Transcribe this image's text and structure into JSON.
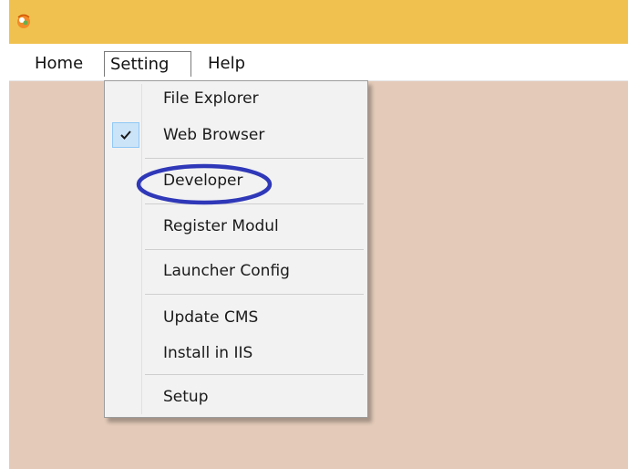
{
  "titlebar": {
    "icon": "app-icon"
  },
  "menubar": {
    "items": [
      {
        "label": "Home"
      },
      {
        "label": "Setting"
      },
      {
        "label": "Help"
      }
    ]
  },
  "setting_menu": {
    "items": [
      {
        "label": "File Explorer",
        "checked": false
      },
      {
        "label": "Web Browser",
        "checked": true
      },
      {
        "label": "Developer",
        "checked": false,
        "circled": true
      },
      {
        "label": "Register Modul",
        "checked": false
      },
      {
        "label": "Launcher Config",
        "checked": false
      },
      {
        "label": "Update CMS",
        "checked": false
      },
      {
        "label": "Install in IIS",
        "checked": false
      },
      {
        "label": "Setup",
        "checked": false
      }
    ]
  },
  "colors": {
    "titlebar": "#f0c14e",
    "client_background": "#e4cbb9",
    "menu_background": "#f2f2f2",
    "check_highlight": "#cce4f7",
    "annotation_ellipse": "#2f38b8"
  }
}
